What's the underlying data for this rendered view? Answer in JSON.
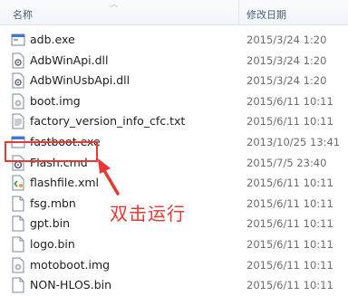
{
  "header": {
    "name_label": "名称",
    "date_label": "修改日期"
  },
  "files": [
    {
      "name": "adb.exe",
      "date": "2015/3/24 1:20",
      "icon": "exe-icon"
    },
    {
      "name": "AdbWinApi.dll",
      "date": "2015/3/24 1:20",
      "icon": "dll-icon"
    },
    {
      "name": "AdbWinUsbApi.dll",
      "date": "2015/3/24 1:20",
      "icon": "dll-icon"
    },
    {
      "name": "boot.img",
      "date": "2015/6/11 10:11",
      "icon": "img-icon"
    },
    {
      "name": "factory_version_info_cfc.txt",
      "date": "2015/6/11 10:11",
      "icon": "txt-icon"
    },
    {
      "name": "fastboot.exe",
      "date": "2013/10/25 13:41",
      "icon": "exe-icon"
    },
    {
      "name": "Flash.cmd",
      "date": "2015/7/5 23:40",
      "icon": "cmd-icon"
    },
    {
      "name": "flashfile.xml",
      "date": "2015/6/11 10:11",
      "icon": "xml-icon"
    },
    {
      "name": "fsg.mbn",
      "date": "2015/6/11 10:11",
      "icon": "file-icon"
    },
    {
      "name": "gpt.bin",
      "date": "2015/6/11 10:11",
      "icon": "file-icon"
    },
    {
      "name": "logo.bin",
      "date": "2015/6/11 10:11",
      "icon": "file-icon"
    },
    {
      "name": "motoboot.img",
      "date": "2015/6/11 10:11",
      "icon": "img-icon"
    },
    {
      "name": "NON-HLOS.bin",
      "date": "2015/6/11 10:11",
      "icon": "file-icon"
    }
  ],
  "annotation": {
    "text": "双击运行",
    "color": "#e53935"
  }
}
